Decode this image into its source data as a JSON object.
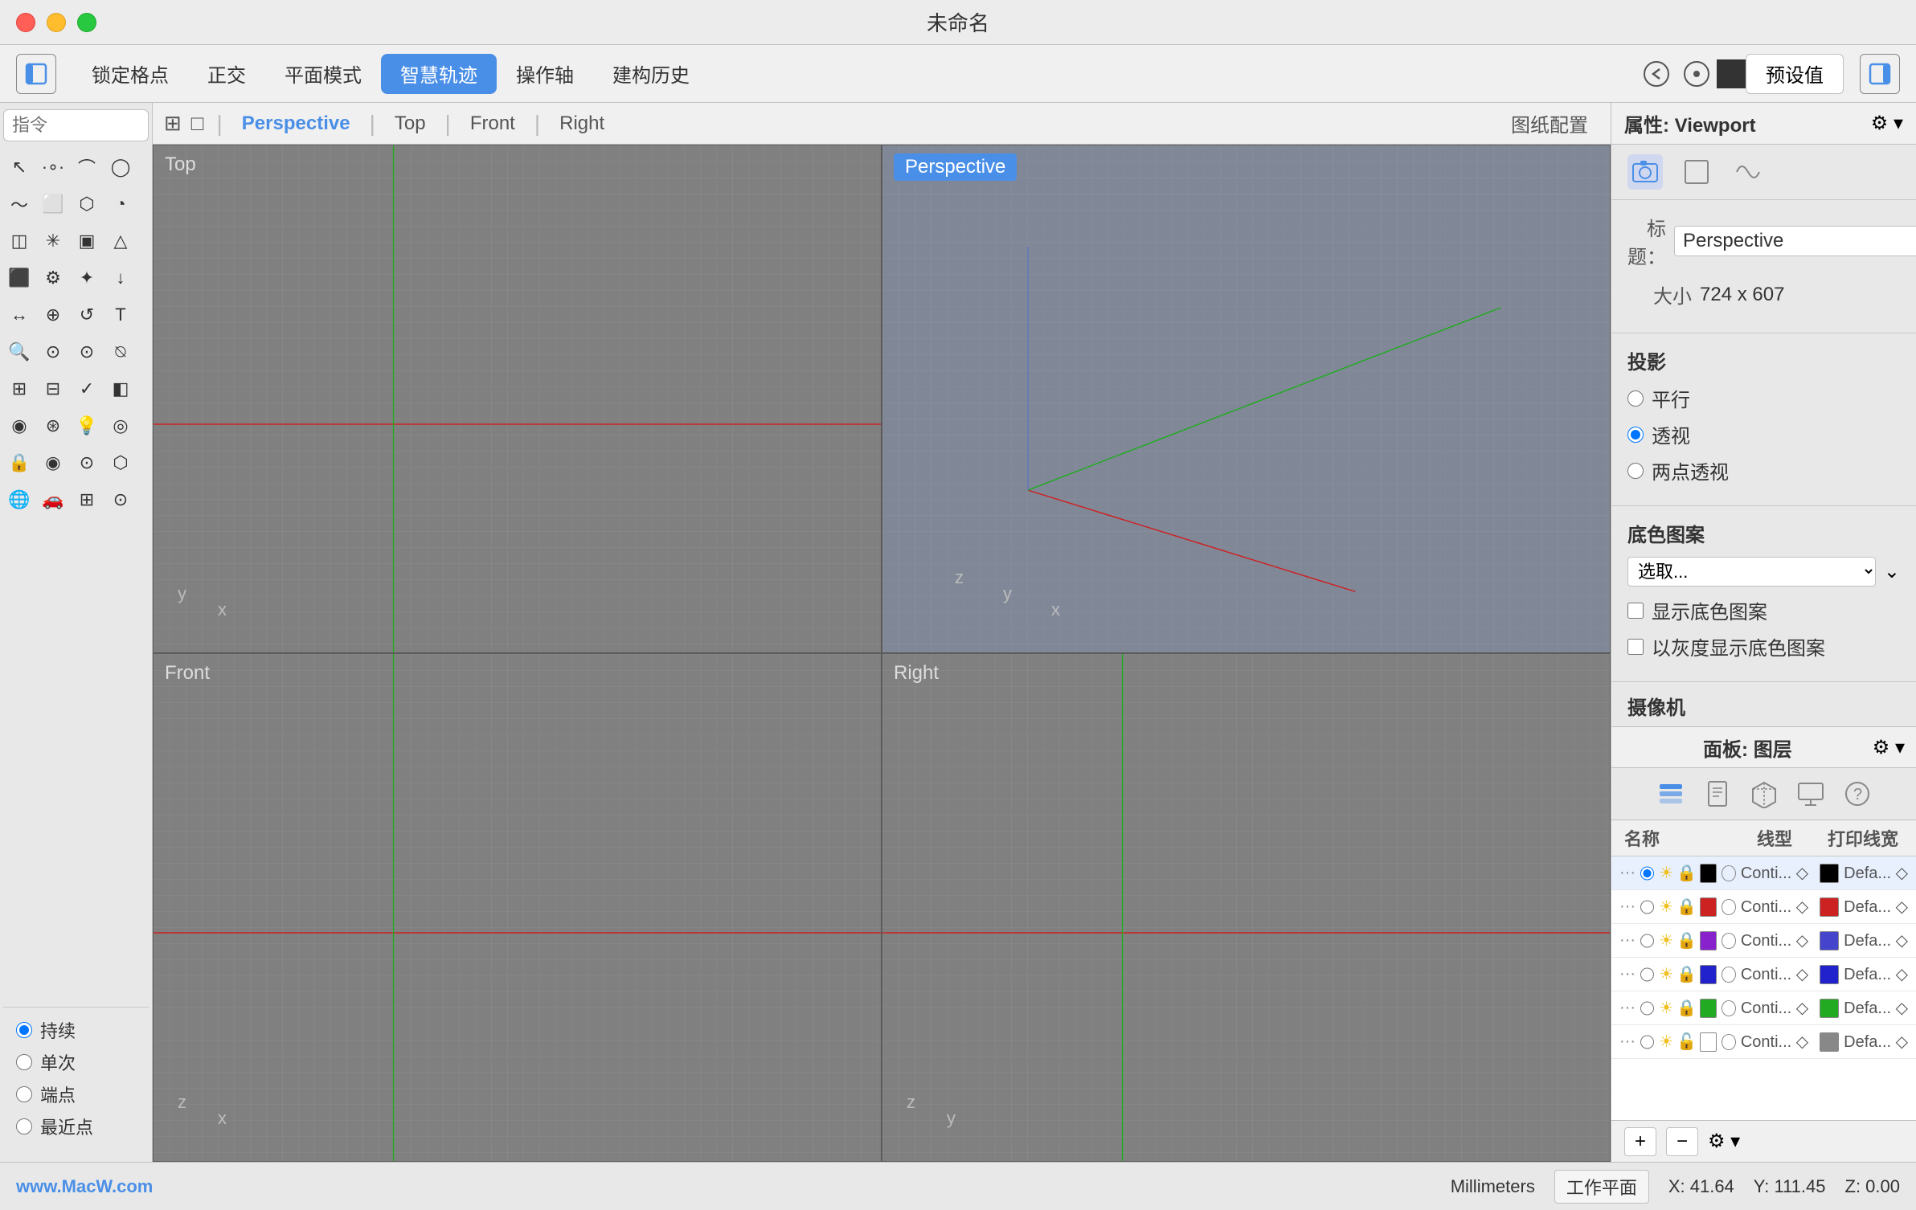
{
  "window": {
    "title": "未命名"
  },
  "toolbar": {
    "lock_grid": "锁定格点",
    "ortho": "正交",
    "planar_mode": "平面模式",
    "smart_track": "智慧轨迹",
    "operation_axis": "操作轴",
    "build_history": "建构历史",
    "preset": "预设值"
  },
  "viewport_tabs": {
    "icon_grid": "⊞",
    "icon_box": "□",
    "tabs": [
      "Perspective",
      "Top",
      "Front",
      "Right"
    ],
    "settings": "图纸配置"
  },
  "viewports": [
    {
      "id": "top",
      "label": "Top",
      "active": false
    },
    {
      "id": "perspective",
      "label": "Perspective",
      "active": true
    },
    {
      "id": "front",
      "label": "Front",
      "active": false
    },
    {
      "id": "right",
      "label": "Right",
      "active": false
    }
  ],
  "right_panel": {
    "title": "属性: Viewport",
    "icons": [
      "📷",
      "□",
      "⬡"
    ],
    "title_label": "标题：",
    "title_value": "Perspective",
    "size_label": "大小",
    "size_value": "724 x 607",
    "projection_label": "投影",
    "projection_options": [
      "平行",
      "透视",
      "两点透视"
    ],
    "projection_selected": "透视",
    "bg_pattern_label": "底色图案",
    "bg_select_label": "选取...",
    "bg_show_label": "显示底色图案",
    "bg_gray_label": "以灰度显示底色图案",
    "camera_label": "摄像机"
  },
  "layers_panel": {
    "title": "面板: 图层",
    "icons": [
      "⬛",
      "□",
      "⬡",
      "⬜",
      "?"
    ],
    "columns": {
      "name": "名称",
      "linetype": "线型",
      "linewidth": "打印线宽"
    },
    "layers": [
      {
        "color": "#000000",
        "linetype": "Conti...",
        "linewidth_color": "#000000",
        "selected": true
      },
      {
        "color": "#cc2222",
        "linetype": "Conti...",
        "linewidth_color": "#cc2222",
        "selected": false
      },
      {
        "color": "#8822cc",
        "linetype": "Conti...",
        "linewidth_color": "#4444cc",
        "selected": false
      },
      {
        "color": "#2222cc",
        "linetype": "Conti...",
        "linewidth_color": "#2222cc",
        "selected": false
      },
      {
        "color": "#22aa22",
        "linetype": "Conti...",
        "linewidth_color": "#22aa22",
        "selected": false
      },
      {
        "color": "#ffffff",
        "linetype": "Conti...",
        "linewidth_color": "#888888",
        "selected": false
      }
    ],
    "footer": {
      "add": "+",
      "remove": "−",
      "settings": "⚙"
    }
  },
  "statusbar": {
    "logo_text": "www.MacW.com",
    "units": "Millimeters",
    "workplane": "工作平面",
    "x": "X: 41.64",
    "y": "Y: 111.45",
    "z": "Z: 0.00"
  },
  "bottom_left": {
    "options": [
      "持续",
      "单次",
      "端点",
      "最近点"
    ]
  }
}
